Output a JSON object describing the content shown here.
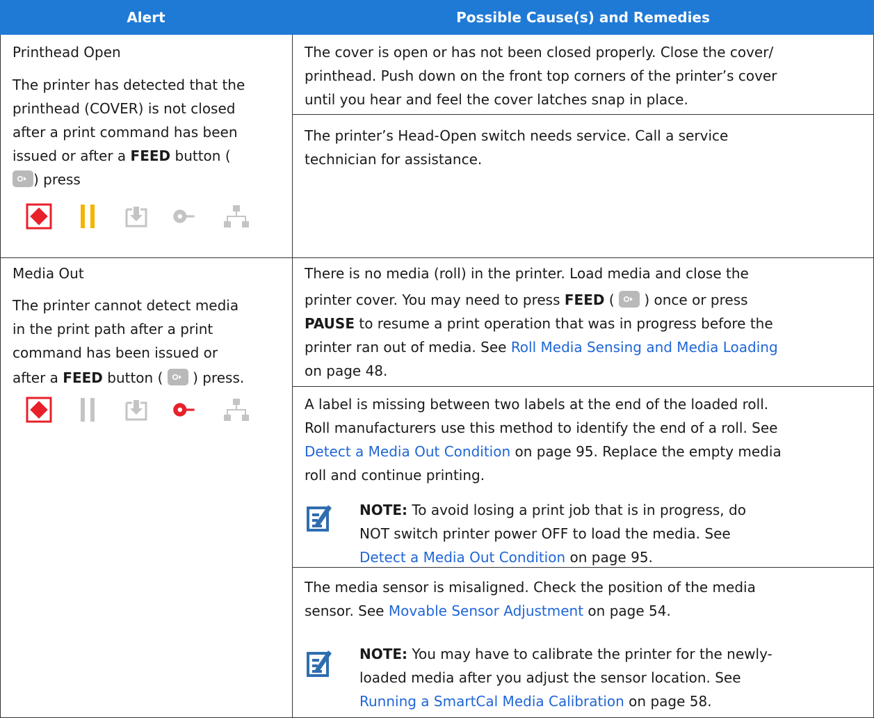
{
  "header": {
    "alert": "Alert",
    "remedy": "Possible Cause(s) and Remedies"
  },
  "rows": [
    {
      "title": "Printhead Open",
      "desc": [
        "The printer has detected that the",
        "printhead (COVER) is not closed",
        "after a print command has been",
        "issued or after a",
        "FEED",
        "button (",
        ") press"
      ],
      "remedies": [
        {
          "lines": [
            "The cover is open or has not been closed properly. Close the cover/",
            "printhead. Push down on the front top corners of the printer’s cover",
            "until you hear and feel the cover latches snap in place."
          ]
        },
        {
          "lines": [
            "The printer’s Head-Open switch needs service. Call a service",
            "technician for assistance."
          ]
        }
      ]
    },
    {
      "title": "Media Out",
      "desc": [
        "The printer cannot detect media",
        "in the print path after a print",
        "command has been issued or",
        "after a",
        "FEED",
        "button (",
        ") press."
      ],
      "remedy1": {
        "l1": "There is no media (roll) in the printer. Load media and close the",
        "l2a": "printer cover. You may need to press",
        "l2b": "FEED",
        "l2c": "(",
        "l2d": ") once or press",
        "l3a": "PAUSE",
        "l3b": "to resume a print operation that was in progress before the",
        "l4a": "printer ran out of media. See",
        "l4b": "Roll Media Sensing and Media Loading",
        "l5": "on page 48."
      },
      "remedy2": {
        "l1": "A label is missing between two labels at the end of the loaded roll.",
        "l2": "Roll manufacturers use this method to identify the end of a roll. See",
        "l3a": "Detect a Media Out Condition",
        "l3b": "on page 95. Replace the empty media",
        "l4": "roll and continue printing.",
        "note_a": "NOTE:",
        "note_b": "To avoid losing a print job that is in progress, do",
        "note_l2": "NOT switch printer power OFF to load the media. See",
        "note_l3a": "Detect a Media Out Condition",
        "note_l3b": "on page 95."
      },
      "remedy3": {
        "l1": "The media sensor is misaligned. Check the position of the media",
        "l2a": "sensor. See",
        "l2b": "Movable Sensor Adjustment",
        "l2c": "on page 54.",
        "note_a": "NOTE:",
        "note_b": "You may have to calibrate the printer for the newly-",
        "note_l2": "loaded media after you adjust the sensor location. See",
        "note_l3a": "Running a SmartCal Media Calibration",
        "note_l3b": "on page 58."
      }
    }
  ],
  "indicators": {
    "row1": [
      "status-icon-red",
      "pause-icon-amber",
      "data-icon-gray",
      "supplies-icon-gray",
      "network-icon-gray"
    ],
    "row2": [
      "status-icon-red",
      "pause-icon-gray",
      "data-icon-gray",
      "supplies-icon-red",
      "network-icon-gray"
    ]
  },
  "colors": {
    "header_bg": "#1f7ad6",
    "link": "#1f66d6",
    "red": "#e8202a",
    "amber": "#f4b400",
    "gray_icon": "#c4c4c4",
    "note_blue": "#2f6db0"
  }
}
